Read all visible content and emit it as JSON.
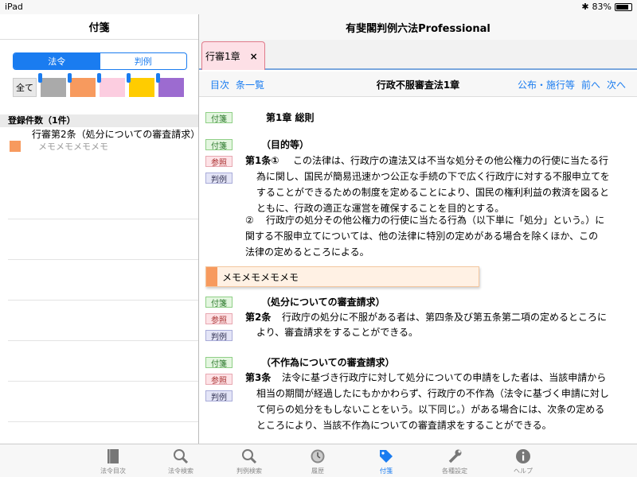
{
  "status": {
    "device": "iPad",
    "battery": "83%"
  },
  "left": {
    "title": "付箋",
    "segments": [
      "法令",
      "判例"
    ],
    "all_label": "全て",
    "swatches": [
      "#aaaaaa",
      "#f79a5e",
      "#fccde0",
      "#ffcc00",
      "#9c6bd0"
    ],
    "count_header": "登録件数（1件）",
    "bookmark": {
      "title": "行審第2条（処分についての審査請求）",
      "memo": "メモメモメモメモ",
      "color": "#f79a5e"
    }
  },
  "right": {
    "title": "有斐閣判例六法Professional",
    "tab_label": "行審1章",
    "tab_close": "×",
    "nav_left": [
      "目次",
      "条一覧"
    ],
    "nav_center": "行政不服審査法1章",
    "nav_right": [
      "公布・施行等",
      "前へ",
      "次へ"
    ],
    "badges": {
      "fusen": "付箋",
      "sansho": "参照",
      "hanrei": "判例"
    },
    "chapter": "第1章 総則",
    "art1_caption": "（目的等）",
    "art1_num": "第1条①",
    "art1_lines": [
      "この法律は、行政庁の違法又は不当な処分その他公権力の行使に当たる行",
      "為に関し、国民が簡易迅速かつ公正な手続の下で広く行政庁に対する不服申立てを",
      "することができるための制度を定めることにより、国民の権利利益の救済を図ると",
      "ともに、行政の適正な運営を確保することを目的とする。"
    ],
    "art1_p2_num": "②",
    "art1_p2_lines": [
      "行政庁の処分その他公権力の行使に当たる行為（以下単に「処分」という。）に",
      "関する不服申立てについては、他の法律に特別の定めがある場合を除くほか、この",
      "法律の定めるところによる。"
    ],
    "memo": "メモメモメモメモ",
    "art2_caption": "（処分についての審査請求）",
    "art2_num": "第2条",
    "art2_lines": [
      "行政庁の処分に不服がある者は、第四条及び第五条第二項の定めるところに",
      "より、審査請求をすることができる。"
    ],
    "art3_caption": "（不作為についての審査請求）",
    "art3_num": "第3条",
    "art3_lines": [
      "法令に基づき行政庁に対して処分についての申請をした者は、当該申請から",
      "相当の期間が経過したにもかかわらず、行政庁の不作為（法令に基づく申請に対し",
      "て何らの処分をもしないことをいう。以下同じ。）がある場合には、次条の定める",
      "ところにより、当該不作為についての審査請求をすることができる。"
    ]
  },
  "tabs": [
    "法令目次",
    "法令検索",
    "判例検索",
    "履歴",
    "付箋",
    "各種設定",
    "ヘルプ"
  ],
  "active_tab": "付箋"
}
